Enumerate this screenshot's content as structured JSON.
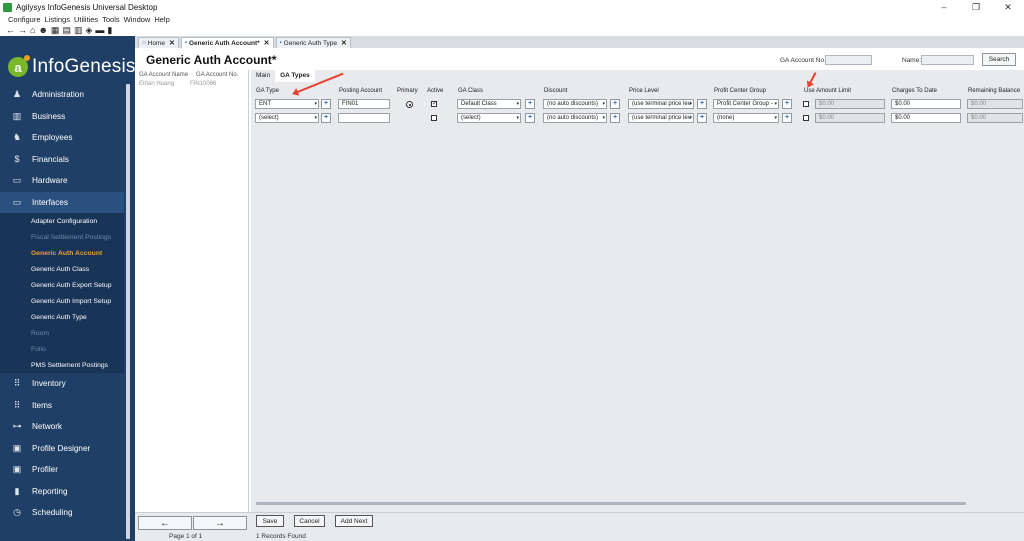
{
  "window": {
    "title": "Agilysys InfoGenesis Universal Desktop",
    "minimize": "–",
    "restore": "❐",
    "close": "✕"
  },
  "menu": [
    "Configure",
    "Listings",
    "Utilities",
    "Tools",
    "Window",
    "Help"
  ],
  "toolbar": [
    "←",
    "→",
    "⌂",
    "☻",
    "▦",
    "▤",
    "▥",
    "◈",
    "▬",
    "▮"
  ],
  "logo": {
    "letter": "a",
    "text": "InfoGenesis"
  },
  "sidebar": {
    "items_top": [
      {
        "label": "Administration",
        "icon": "♟"
      },
      {
        "label": "Business",
        "icon": "▥"
      },
      {
        "label": "Employees",
        "icon": "♞"
      },
      {
        "label": "Financials",
        "icon": "$"
      },
      {
        "label": "Hardware",
        "icon": "▭"
      },
      {
        "label": "Interfaces",
        "icon": "▭"
      }
    ],
    "sub_items": [
      {
        "label": "Adapter Configuration",
        "state": "normal"
      },
      {
        "label": "Fiscal Settlement Postings",
        "state": "dim"
      },
      {
        "label": "Generic Auth Account",
        "state": "active"
      },
      {
        "label": "Generic Auth Class",
        "state": "normal"
      },
      {
        "label": "Generic Auth Export Setup",
        "state": "normal"
      },
      {
        "label": "Generic Auth Import Setup",
        "state": "normal"
      },
      {
        "label": "Generic Auth Type",
        "state": "normal"
      },
      {
        "label": "Room",
        "state": "dim"
      },
      {
        "label": "Folio",
        "state": "dim"
      },
      {
        "label": "PMS Settlement Postings",
        "state": "normal"
      }
    ],
    "items_bottom": [
      {
        "label": "Inventory",
        "icon": "⠿"
      },
      {
        "label": "Items",
        "icon": "⠿"
      },
      {
        "label": "Network",
        "icon": "⊶"
      },
      {
        "label": "Profile Designer",
        "icon": "▣"
      },
      {
        "label": "Profiler",
        "icon": "▣"
      },
      {
        "label": "Reporting",
        "icon": "▮"
      },
      {
        "label": "Scheduling",
        "icon": "◷"
      }
    ]
  },
  "tabs": [
    {
      "label": "Home",
      "active": false,
      "icon": "⌂"
    },
    {
      "label": "Generic Auth Account*",
      "active": true,
      "icon": "▪"
    },
    {
      "label": "Generic Auth Type",
      "active": false,
      "icon": "▪"
    }
  ],
  "header": {
    "title": "Generic Auth Account*",
    "ga_account_label": "GA Account No.:",
    "name_label": "Name:",
    "search_label": "Search"
  },
  "list": {
    "col1": "GA Account Name",
    "col2": "GA Account No.",
    "rows": [
      {
        "name": "Ethan Huang",
        "number": "FIN10086"
      }
    ]
  },
  "subtabs": [
    {
      "label": "Main",
      "active": false
    },
    {
      "label": "GA Types",
      "active": true
    }
  ],
  "grid": {
    "columns": [
      "GA Type",
      "Posting Account",
      "Primary",
      "Active",
      "GA Class",
      "Discount",
      "Price Level",
      "Profit Center Group",
      "Use Amount Limit",
      "Charges To Date",
      "Remaining Balance"
    ],
    "rows": [
      {
        "ga_type": "ENT",
        "posting": "FIN01",
        "primary": true,
        "active": true,
        "ga_class": "Default Class",
        "discount": "(no auto discounts)",
        "price_level": "(use terminal price lev",
        "pcg": "Profit Center Group - ",
        "use_limit": false,
        "limit": "$0.00",
        "charges": "$0.00",
        "remaining": "$0.00"
      },
      {
        "ga_type": "(select)",
        "posting": "",
        "primary": false,
        "active": false,
        "ga_class": "(select)",
        "discount": "(no auto discounts)",
        "price_level": "(use terminal price lev",
        "pcg": "(none)",
        "use_limit": false,
        "limit": "$0.00",
        "charges": "$0.00",
        "remaining": "$0.00"
      }
    ]
  },
  "bottom": {
    "prev": "←",
    "next": "→",
    "save": "Save",
    "cancel": "Cancel",
    "add_next": "Add Next",
    "page": "Page 1 of 1",
    "records": "1 Records Found"
  },
  "colors": {
    "sidebar": "#1f3f66",
    "active_nav": "#f0a028",
    "annotation_arrow": "#e8402a"
  }
}
